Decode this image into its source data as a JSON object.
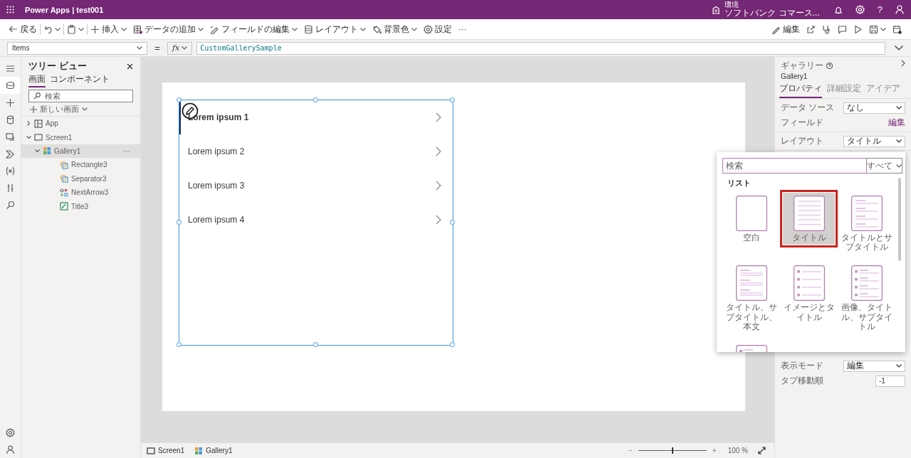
{
  "top_bar": {
    "app_title": "Power Apps | test001",
    "environment_label": "環境",
    "environment_name": "ソフトバンク コマース...",
    "help": "?"
  },
  "command_bar": {
    "left": [
      {
        "kind": "back",
        "label": "戻る",
        "dropdown": false,
        "separator_after": true
      },
      {
        "kind": "undo",
        "dropdown": true,
        "separator_after": true
      },
      {
        "kind": "paste",
        "dropdown": true,
        "separator_after": true
      },
      {
        "kind": "insert",
        "label": "挿入",
        "dropdown": true,
        "separator_after": false
      },
      {
        "kind": "data",
        "label": "データの追加",
        "dropdown": true,
        "separator_after": false
      },
      {
        "kind": "fields",
        "label": "フィールドの編集",
        "dropdown": true,
        "separator_after": false
      },
      {
        "kind": "layout",
        "label": "レイアウト",
        "dropdown": true,
        "separator_after": false
      },
      {
        "kind": "background",
        "label": "背景色",
        "dropdown": true,
        "separator_after": false
      },
      {
        "kind": "settings",
        "label": "設定",
        "dropdown": false,
        "separator_after": false
      },
      {
        "kind": "more",
        "label": "···",
        "dropdown": false,
        "separator_after": false
      }
    ],
    "right": [
      {
        "kind": "edit",
        "label": "編集",
        "dropdown": false
      },
      {
        "kind": "share",
        "dropdown": false
      },
      {
        "kind": "checker",
        "dropdown": false
      },
      {
        "kind": "comment",
        "dropdown": false
      },
      {
        "kind": "play",
        "dropdown": false
      },
      {
        "kind": "save",
        "dropdown": true
      },
      {
        "kind": "publish",
        "dropdown": false
      }
    ]
  },
  "formula_bar": {
    "property": "Items",
    "equals": "=",
    "fx": "fx",
    "formula": "CustomGallerySample"
  },
  "left_rail": [
    {
      "kind": "menu",
      "selected": false
    },
    {
      "kind": "tree",
      "selected": true
    },
    {
      "kind": "insert",
      "selected": false
    },
    {
      "kind": "data",
      "selected": false
    },
    {
      "kind": "media",
      "selected": false
    },
    {
      "kind": "power",
      "selected": false
    },
    {
      "kind": "variables",
      "selected": false
    },
    {
      "kind": "advanced",
      "selected": false
    },
    {
      "kind": "search",
      "selected": false
    },
    {
      "kind": "settings",
      "selected": false
    },
    {
      "kind": "account",
      "selected": false
    }
  ],
  "tree_view": {
    "title": "ツリー ビュー",
    "tabs": [
      {
        "label": "画面",
        "selected": true
      },
      {
        "label": "コンポーネント",
        "selected": false
      }
    ],
    "search_placeholder": "検索",
    "new_screen": "新しい画面",
    "items": [
      {
        "label": "App",
        "kind": "app",
        "expanded": false,
        "selected": false
      },
      {
        "label": "Screen1",
        "kind": "screen",
        "expanded": true,
        "selected": false,
        "children": [
          {
            "label": "Gallery1",
            "kind": "gallery",
            "expanded": true,
            "selected": true,
            "more": "···",
            "children": [
              {
                "label": "Rectangle3",
                "kind": "shape",
                "selected": false
              },
              {
                "label": "Separator3",
                "kind": "shape",
                "selected": false
              },
              {
                "label": "NextArrow3",
                "kind": "icon",
                "selected": false
              },
              {
                "label": "Title3",
                "kind": "label",
                "selected": false
              }
            ]
          }
        ]
      }
    ]
  },
  "gallery": {
    "items": [
      {
        "title": "Lorem ipsum 1",
        "selected": true
      },
      {
        "title": "Lorem ipsum 2",
        "selected": false
      },
      {
        "title": "Lorem ipsum 3",
        "selected": false
      },
      {
        "title": "Lorem ipsum 4",
        "selected": false
      }
    ]
  },
  "properties_panel": {
    "type": "ギャラリー",
    "name": "Gallery1",
    "tabs": [
      {
        "label": "プロパティ",
        "selected": true
      },
      {
        "label": "詳細設定",
        "selected": false
      },
      {
        "label": "アイデア",
        "selected": false
      }
    ],
    "rows": [
      {
        "label": "データ ソース",
        "kind": "dropdown",
        "value": "なし"
      },
      {
        "label": "フィールド",
        "kind": "link",
        "value": "編集"
      },
      {
        "label": "レイアウト",
        "kind": "dropdown",
        "value": "タイトル"
      }
    ],
    "lower_rows": [
      {
        "label": "表示モード",
        "kind": "dropdown",
        "value": "編集"
      },
      {
        "label": "タブ移動順",
        "kind": "number",
        "value": "-1"
      }
    ]
  },
  "layout_picker": {
    "search_placeholder": "検索",
    "filter": "すべて",
    "section": "リスト",
    "layouts": [
      {
        "label": "空白",
        "kind": "blank",
        "selected": false
      },
      {
        "label": "タイトル",
        "kind": "title",
        "selected": true
      },
      {
        "label": "タイトルとサブタイトル",
        "kind": "title-subtitle",
        "selected": false
      },
      {
        "label": "タイトル、サブタイトル、本文",
        "kind": "title-subtitle-body",
        "selected": false
      },
      {
        "label": "イメージとタイトル",
        "kind": "image-title",
        "selected": false
      },
      {
        "label": "画像、タイトル、サブタイトル",
        "kind": "image-title-subtitle",
        "selected": false
      },
      {
        "kind": "image-title-subtitle",
        "selected": false
      }
    ]
  },
  "status_bar": {
    "breadcrumbs": [
      {
        "label": "Screen1",
        "kind": "screen"
      },
      {
        "label": "Gallery1",
        "kind": "gallery"
      }
    ],
    "zoom_out": "−",
    "zoom_in": "+",
    "zoom": {
      "level": 0.5
    },
    "zoom_reading": "100 %"
  }
}
